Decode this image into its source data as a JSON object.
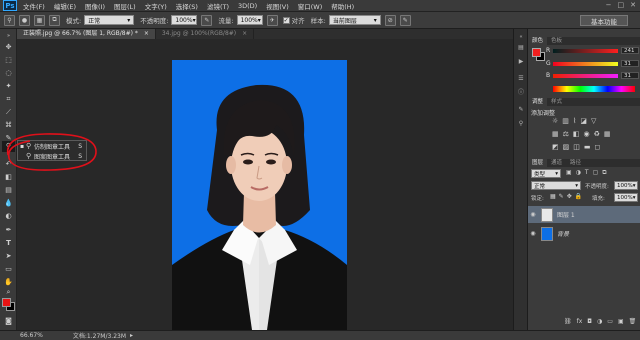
{
  "app": {
    "logo": "Ps"
  },
  "menubar": {
    "items": [
      "文件(F)",
      "编辑(E)",
      "图像(I)",
      "图层(L)",
      "文字(Y)",
      "选择(S)",
      "滤镜(T)",
      "3D(D)",
      "视图(V)",
      "窗口(W)",
      "帮助(H)"
    ],
    "window_controls": [
      "−",
      "□",
      "✕"
    ]
  },
  "options_bar": {
    "mode_label": "模式:",
    "mode_value": "正常",
    "opacity_label": "不透明度:",
    "opacity_value": "100%",
    "flow_label": "流量:",
    "flow_value": "100%",
    "aligned_label": "对齐",
    "sample_label": "样本:",
    "sample_value": "当前图层",
    "workspace": "基本功能"
  },
  "document_tabs": [
    {
      "label": "正装照.jpg @ 66.7% (图层 1, RGB/8#) *",
      "close": "×"
    },
    {
      "label": "34.jpg @ 100%(RGB/8#)",
      "close": "×"
    }
  ],
  "tool_flyout": {
    "items": [
      {
        "label": "仿制图章工具",
        "shortcut": "S",
        "selected": true
      },
      {
        "label": "图案图章工具",
        "shortcut": "S",
        "selected": false
      }
    ]
  },
  "panels": {
    "color": {
      "tabs": [
        "颜色",
        "色板"
      ],
      "r_label": "R",
      "r_value": "241",
      "g_label": "G",
      "g_value": "31",
      "b_label": "B",
      "b_value": "31",
      "fg_color": "#f11f1f"
    },
    "adjustments": {
      "tabs": [
        "调整",
        "样式"
      ],
      "title": "添加调整"
    },
    "layers": {
      "tabs": [
        "图层",
        "通道",
        "路径"
      ],
      "filter_label": "类型",
      "blend_value": "正常",
      "opacity_label": "不透明度:",
      "opacity_value": "100%",
      "lock_label": "锁定:",
      "fill_label": "填充:",
      "fill_value": "100%",
      "items": [
        {
          "name": "图层 1",
          "selected": true
        },
        {
          "name": "背景",
          "selected": false
        }
      ]
    }
  },
  "status": {
    "zoom": "66.67%",
    "doc_info": "文档:1.27M/3.23M"
  },
  "colors": {
    "canvas_bg": "#0d6fe6",
    "accent_red": "#e81313",
    "selected_layer": "#5d6a7a"
  }
}
